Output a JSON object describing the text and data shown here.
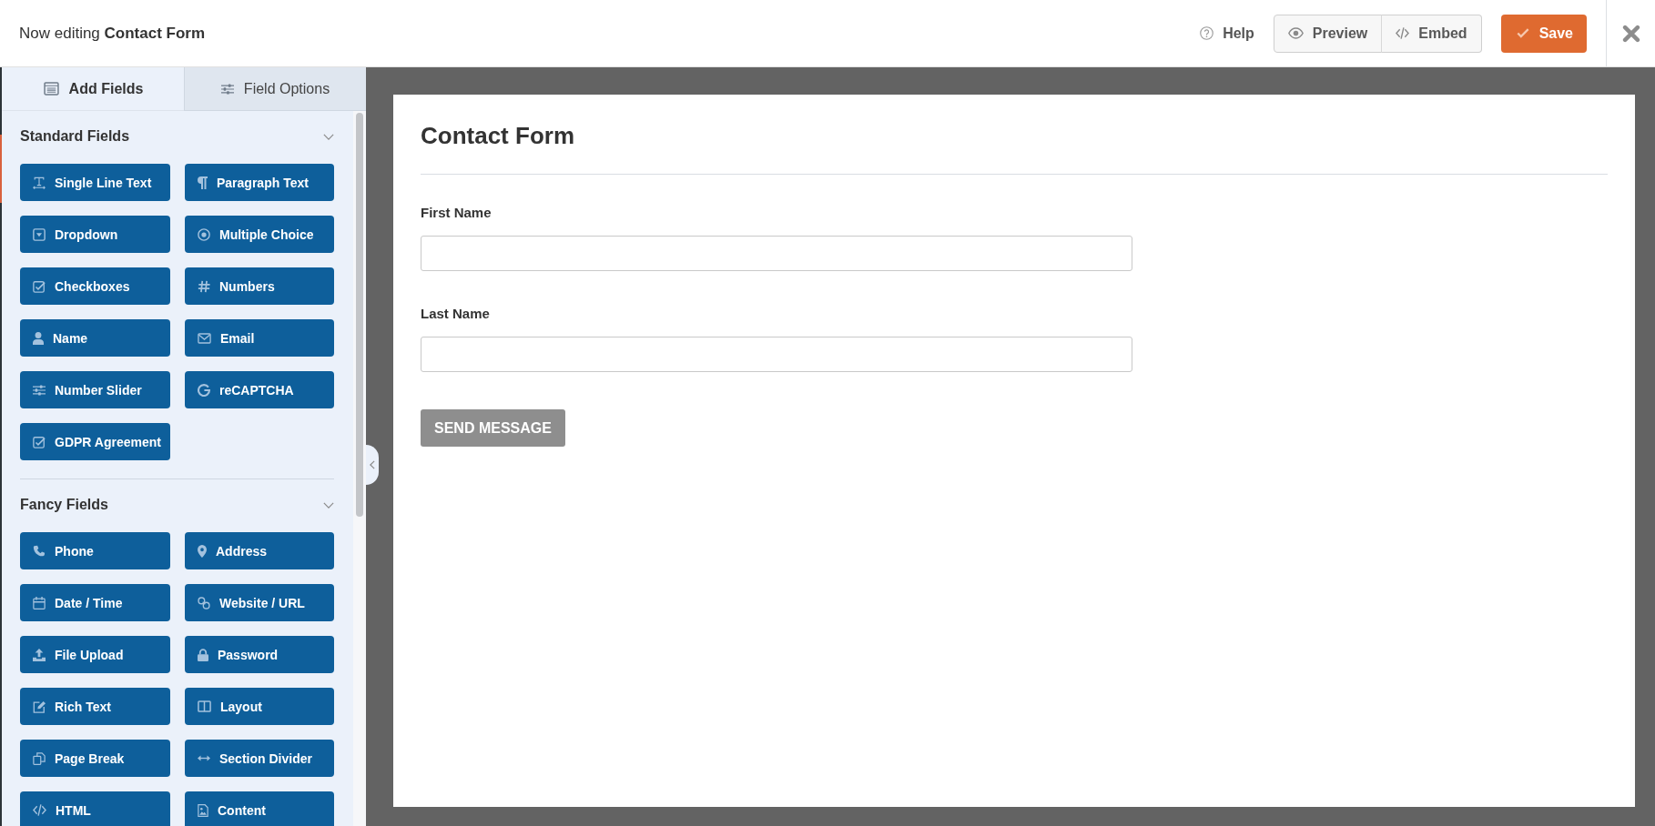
{
  "header": {
    "title": "Now editing **Contact Form**",
    "help": "Help",
    "actions": [
      {
        "label": "Preview"
      },
      {
        "label": "Embed"
      }
    ],
    "save": "Save"
  },
  "sidebar": {
    "tabs": [
      {
        "label": "Add Fields",
        "selected": true
      },
      {
        "label": "Field Options",
        "selected": false
      }
    ],
    "groups": [
      {
        "title": "Standard Fields",
        "expanded": true,
        "fields": [
          "Single Line Text",
          "Paragraph Text",
          "Dropdown",
          "Multiple Choice",
          "Checkboxes",
          "Numbers",
          "Name",
          "Email",
          "Number Slider",
          "reCAPTCHA",
          "GDPR Agreement"
        ]
      },
      {
        "title": "Fancy Fields",
        "expanded": true,
        "fields": [
          "Phone",
          "Address",
          "Date / Time",
          "Website / URL",
          "File Upload",
          "Password",
          "Rich Text",
          "Layout",
          "Page Break",
          "Section Divider",
          "HTML",
          "Content"
        ]
      }
    ]
  },
  "form": {
    "title": "Contact Form",
    "fields": [
      {
        "label": "First Name"
      },
      {
        "label": "Last Name"
      }
    ],
    "submit": "SEND MESSAGE"
  }
}
